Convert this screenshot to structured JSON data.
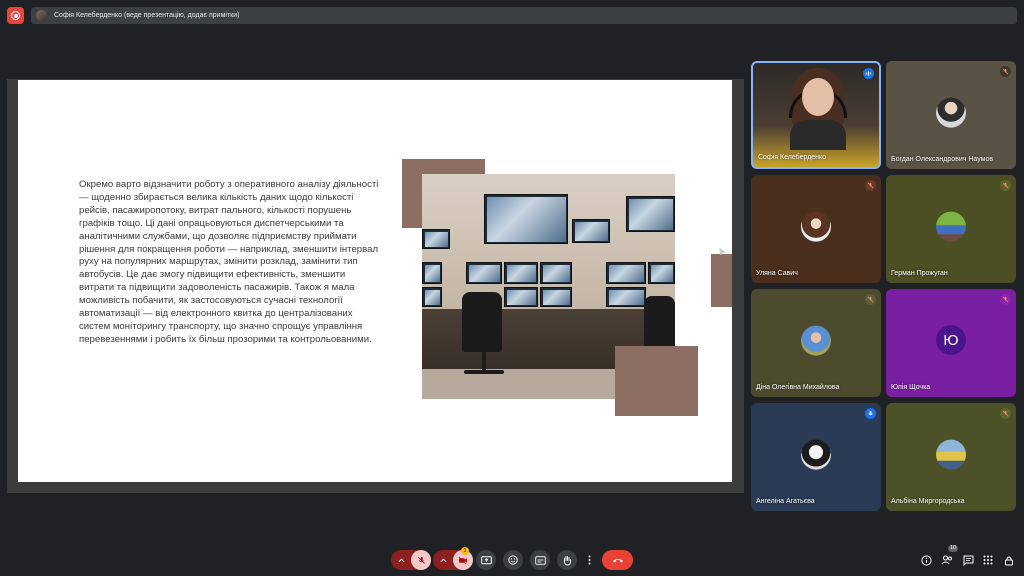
{
  "header": {
    "title": "Софія Келеберденко (веде презентацію, додає примітки)"
  },
  "slide": {
    "paragraph": "Окремо варто відзначити роботу з оперативного аналізу діяльності — щоденно збирається велика кількість даних щодо кількості рейсів, пасажиропотоку, витрат пального, кількості порушень графіків тощо. Ці дані опрацьовуються диспетчерськими та аналітичними службами, що дозволяє підприємству приймати рішення для покращення роботи — наприклад, зменшити інтервал руху на популярних маршрутах, змінити розклад, замінити тип автобусів. Це дає змогу підвищити ефективність, зменшити витрати та підвищити задоволеність пасажирів. Також я мала можливість побачити, як застосовуються сучасні технології автоматизації — від електронного квитка до централізованих систем моніторингу транспорту, що значно спрощує управління перевезеннями і робить їх більш прозорими та контрольованими.",
    "accent_color": "#8d6e63",
    "icon": "globe-icon"
  },
  "participants": [
    {
      "name": "Софія Келеберденко",
      "mic": "speaking",
      "active": true
    },
    {
      "name": "Богдан Олександрович Наумов",
      "mic": "muted"
    },
    {
      "name": "Уляна Савич",
      "mic": "muted"
    },
    {
      "name": "Герман Прожуган",
      "mic": "muted"
    },
    {
      "name": "Діна Олегівна Михайлова",
      "mic": "muted"
    },
    {
      "name": "Юлія Щочка",
      "mic": "muted",
      "initial": "Ю"
    },
    {
      "name": "Ангеліна Агатьєва",
      "mic": "speaking"
    },
    {
      "name": "Альбіна Миргородська",
      "mic": "muted"
    }
  ],
  "controls": {
    "camera_badge": "1",
    "people_count": "10"
  },
  "colors": {
    "end_call": "#ea4335",
    "active_border": "#8ab4f8",
    "muted_badge": "#fbbc04"
  }
}
